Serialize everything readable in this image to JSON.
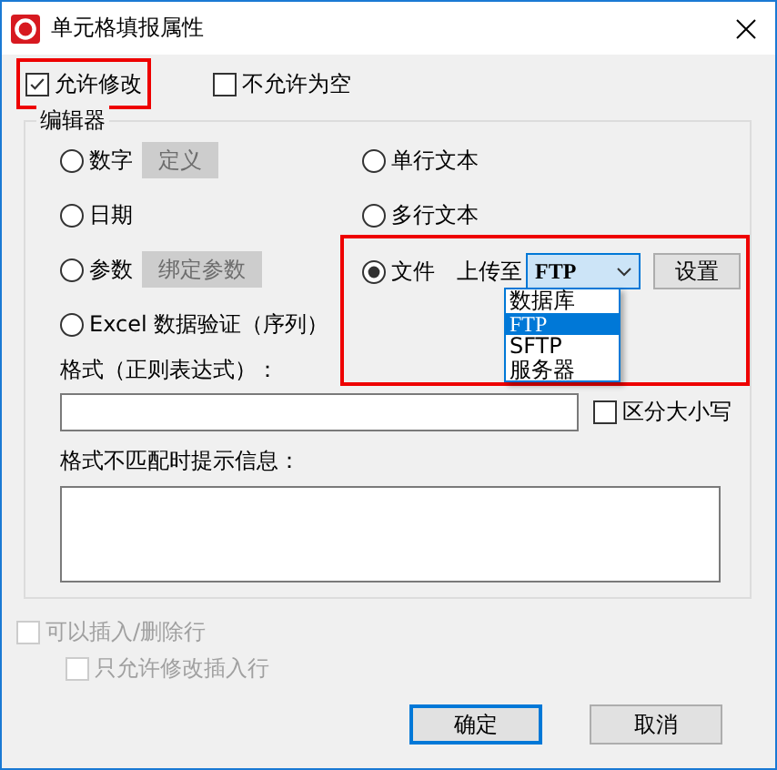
{
  "window": {
    "title": "单元格填报属性"
  },
  "allow_edit": {
    "label": "允许修改",
    "checked": true,
    "highlighted": true
  },
  "not_empty": {
    "label": "不允许为空",
    "checked": false
  },
  "editor": {
    "title": "编辑器",
    "left_options": [
      {
        "label": "数字",
        "selected": false,
        "kind": "button",
        "button": {
          "label": "定义",
          "disabled": true
        }
      },
      {
        "label": "日期",
        "selected": false,
        "kind": "plain"
      },
      {
        "label": "参数",
        "selected": false,
        "kind": "button",
        "button": {
          "label": "绑定参数",
          "disabled": true
        }
      },
      {
        "label": "Excel 数据验证（序列）",
        "selected": false,
        "kind": "plain"
      }
    ],
    "right_options": [
      {
        "label": "单行文本",
        "selected": false,
        "kind": "plain"
      },
      {
        "label": "多行文本",
        "selected": false,
        "kind": "plain"
      },
      {
        "label": "文件",
        "selected": true,
        "kind": "file",
        "highlighted": true,
        "upload_label": "上传至",
        "combo": {
          "value": "FTP",
          "expanded": true,
          "options": [
            {
              "label": "数据库",
              "selected": false
            },
            {
              "label": "FTP",
              "selected": true
            },
            {
              "label": "SFTP",
              "selected": false
            },
            {
              "label": "服务器",
              "selected": false
            }
          ]
        },
        "button": {
          "label": "设置",
          "disabled": false
        }
      }
    ],
    "format_label": "格式（正则表达式）：",
    "case_sensitive": {
      "label": "区分大小写",
      "checked": false
    },
    "message_label": "格式不匹配时提示信息："
  },
  "allow_insert_delete": {
    "label": "可以插入/删除行",
    "checked": false,
    "disabled": true
  },
  "only_edit_inserted": {
    "label": "只允许修改插入行",
    "checked": false,
    "disabled": true
  },
  "buttons": [
    {
      "label": "确定",
      "default": true
    },
    {
      "label": "取消",
      "default": false
    }
  ]
}
